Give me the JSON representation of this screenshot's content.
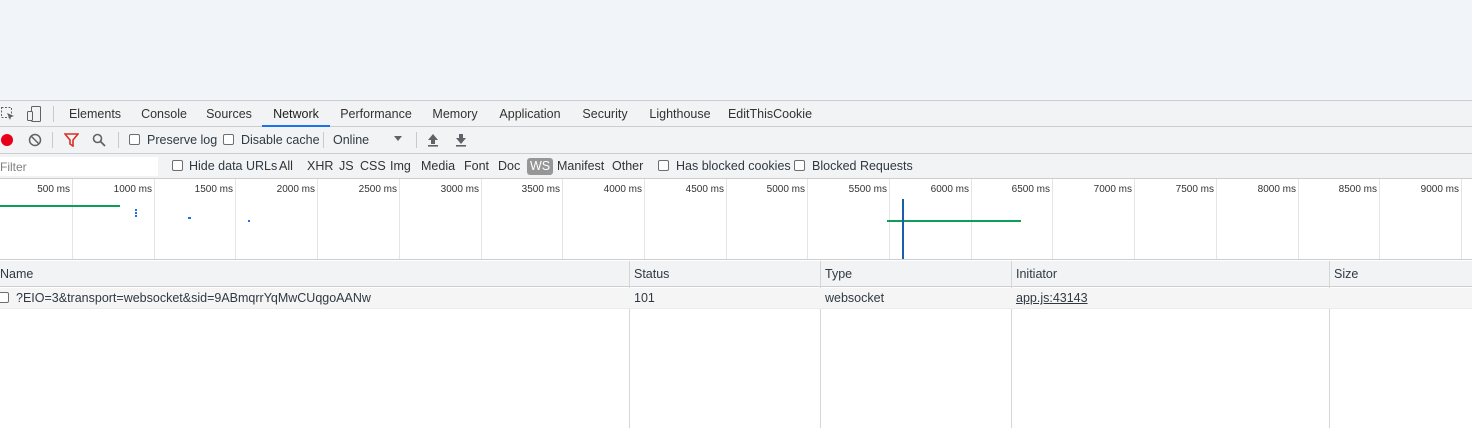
{
  "tabs": [
    "Elements",
    "Console",
    "Sources",
    "Network",
    "Performance",
    "Memory",
    "Application",
    "Security",
    "Lighthouse",
    "EditThisCookie"
  ],
  "active_tab": "Network",
  "toolbar": {
    "preserve_log": "Preserve log",
    "disable_cache": "Disable cache",
    "throttling": "Online"
  },
  "filter": {
    "placeholder": "Filter",
    "hide_data_urls": "Hide data URLs",
    "types": [
      "All",
      "XHR",
      "JS",
      "CSS",
      "Img",
      "Media",
      "Font",
      "Doc",
      "WS",
      "Manifest",
      "Other"
    ],
    "active_type": "WS",
    "has_blocked_cookies": "Has blocked cookies",
    "blocked_requests": "Blocked Requests"
  },
  "timeline": {
    "ticks": [
      "500 ms",
      "1000 ms",
      "1500 ms",
      "2000 ms",
      "2500 ms",
      "3000 ms",
      "3500 ms",
      "4000 ms",
      "4500 ms",
      "5000 ms",
      "5500 ms",
      "6000 ms",
      "6500 ms",
      "7000 ms",
      "7500 ms",
      "8000 ms",
      "8500 ms",
      "9000 ms"
    ],
    "colors": {
      "green": "#0f9d58",
      "blue": "#1a73e8"
    }
  },
  "table": {
    "columns": [
      "Name",
      "Status",
      "Type",
      "Initiator",
      "Size"
    ],
    "rows": [
      {
        "name": "?EIO=3&transport=websocket&sid=9ABmqrrYqMwCUqgoAANw",
        "status": "101",
        "type": "websocket",
        "initiator": "app.js:43143",
        "size": ""
      }
    ]
  }
}
